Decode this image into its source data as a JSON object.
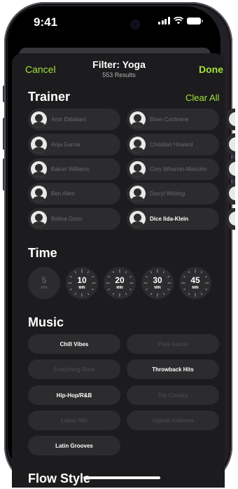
{
  "status": {
    "time": "9:41"
  },
  "nav": {
    "cancel": "Cancel",
    "title": "Filter: Yoga",
    "subtitle": "553 Results",
    "done": "Done"
  },
  "trainer": {
    "heading": "Trainer",
    "clear_all": "Clear All",
    "left": [
      {
        "name": "Amir Ekbatani",
        "selected": false
      },
      {
        "name": "Anja Garcia",
        "selected": false
      },
      {
        "name": "Bakari Williams",
        "selected": false
      },
      {
        "name": "Ben Allen",
        "selected": false
      },
      {
        "name": "Betina Gozo",
        "selected": false
      }
    ],
    "right": [
      {
        "name": "Brian Cochrane",
        "selected": false
      },
      {
        "name": "Christian Howard",
        "selected": false
      },
      {
        "name": "Cory Wharton-Malcolm",
        "selected": false
      },
      {
        "name": "Darryl Whiting",
        "selected": false
      },
      {
        "name": "Dice Iida-Klein",
        "selected": true
      }
    ]
  },
  "time": {
    "heading": "Time",
    "options": [
      {
        "value": "5",
        "unit": "MIN",
        "selected": false
      },
      {
        "value": "10",
        "unit": "MIN",
        "selected": true
      },
      {
        "value": "20",
        "unit": "MIN",
        "selected": true
      },
      {
        "value": "30",
        "unit": "MIN",
        "selected": true
      },
      {
        "value": "45",
        "unit": "MIN",
        "selected": true
      }
    ]
  },
  "music": {
    "heading": "Music",
    "options": [
      {
        "label": "Chill Vibes",
        "selected": true
      },
      {
        "label": "Pure Dance",
        "selected": false
      },
      {
        "label": "Everything Rock",
        "selected": false
      },
      {
        "label": "Throwback Hits",
        "selected": true
      },
      {
        "label": "Hip-Hop/R&B",
        "selected": true
      },
      {
        "label": "Top Country",
        "selected": false
      },
      {
        "label": "Latest Hits",
        "selected": false
      },
      {
        "label": "Upbeat Anthems",
        "selected": false
      },
      {
        "label": "Latin Grooves",
        "selected": true
      }
    ]
  },
  "next_section": {
    "heading": "Flow Style"
  },
  "colors": {
    "accent": "#a4e23c",
    "sheet": "#1c1c1e",
    "chip": "#2c2c2e"
  }
}
